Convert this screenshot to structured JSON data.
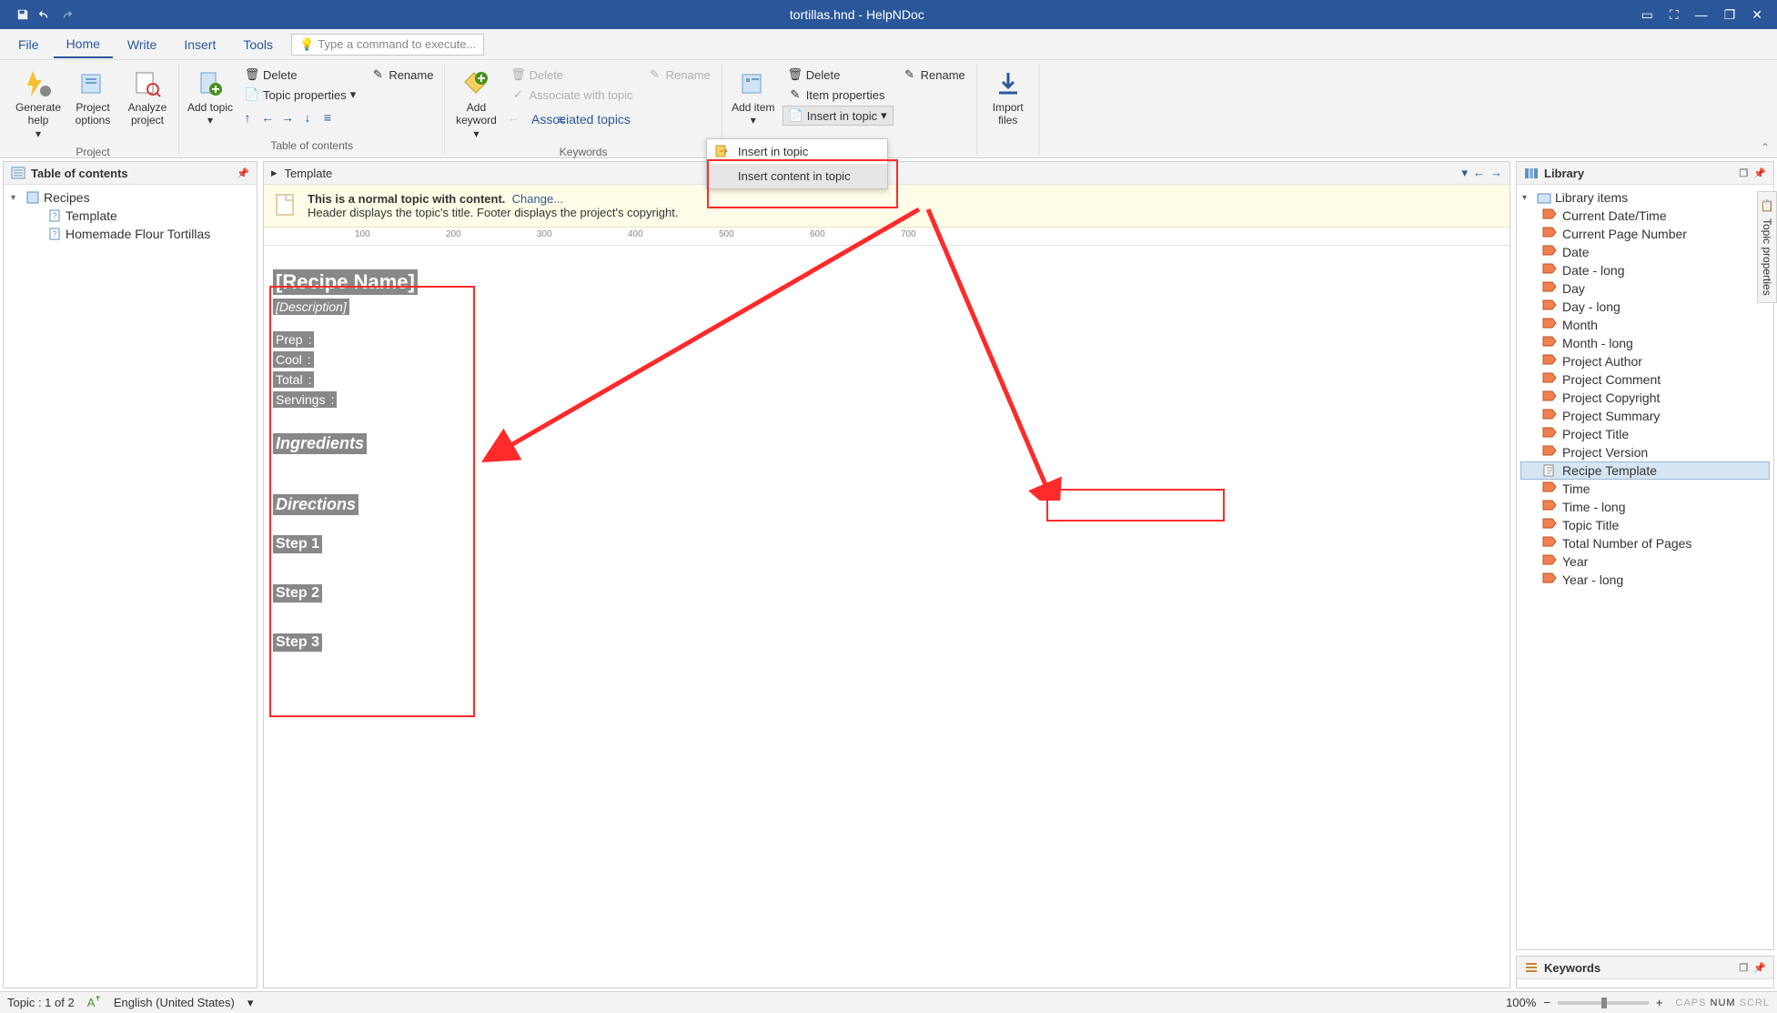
{
  "window": {
    "title": "tortillas.hnd - HelpNDoc"
  },
  "tabs": [
    "File",
    "Home",
    "Write",
    "Insert",
    "Tools"
  ],
  "active_tab": "Home",
  "command_box_placeholder": "Type a command to execute...",
  "ribbon": {
    "groups": {
      "project": {
        "label": "Project",
        "generate": "Generate help",
        "options": "Project options",
        "analyze": "Analyze project"
      },
      "toc": {
        "label": "Table of contents",
        "add": "Add topic",
        "delete": "Delete",
        "rename": "Rename",
        "props": "Topic properties"
      },
      "keywords": {
        "label": "Keywords",
        "add": "Add keyword",
        "delete": "Delete",
        "rename": "Rename",
        "associate": "Associate with topic",
        "associated": "Associated topics"
      },
      "library": {
        "add": "Add item",
        "delete": "Delete",
        "rename": "Rename",
        "props": "Item properties",
        "insert": "Insert in topic"
      },
      "import": {
        "label": "Import files"
      }
    },
    "dropdown": {
      "item1": "Insert in topic",
      "item2": "Insert content in topic"
    }
  },
  "toc_panel": {
    "title": "Table of contents",
    "root": "Recipes",
    "children": [
      "Template",
      "Homemade Flour Tortillas"
    ]
  },
  "breadcrumb": "Template",
  "infobar": {
    "bold": "This is a normal topic with content.",
    "change": "Change...",
    "line2": "Header displays the topic's title.   Footer displays the project's copyright."
  },
  "ruler_marks": [
    "100",
    "200",
    "300",
    "400",
    "500",
    "600",
    "700"
  ],
  "doc": {
    "title": "[Recipe Name]",
    "desc": "[Description]",
    "prep": "Prep",
    "cool": "Cool",
    "total": "Total",
    "servings": "Servings",
    "ingredients": "Ingredients",
    "directions": "Directions",
    "step1": "Step 1",
    "step2": "Step 2",
    "step3": "Step 3"
  },
  "library": {
    "title": "Library",
    "root": "Library items",
    "items": [
      "Current Date/Time",
      "Current Page Number",
      "Date",
      "Date - long",
      "Day",
      "Day - long",
      "Month",
      "Month - long",
      "Project Author",
      "Project Comment",
      "Project Copyright",
      "Project Summary",
      "Project Title",
      "Project Version",
      "Recipe Template",
      "Time",
      "Time - long",
      "Topic Title",
      "Total Number of Pages",
      "Year",
      "Year - long"
    ],
    "selected": "Recipe Template"
  },
  "keywords_panel": "Keywords",
  "vtab": "Topic properties",
  "status": {
    "topic": "Topic : 1 of 2",
    "lang": "English (United States)",
    "zoom": "100%",
    "caps": "CAPS",
    "num": "NUM",
    "scrl": "SCRL"
  }
}
